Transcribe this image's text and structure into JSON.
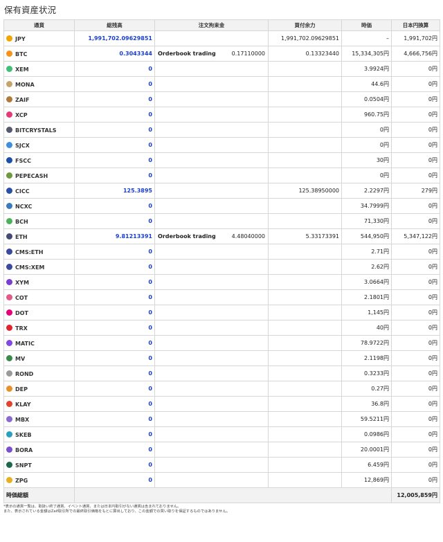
{
  "page_title": "保有資産状況",
  "columns": [
    "通貨",
    "総残高",
    "注文拘束金",
    "買付余力",
    "時価",
    "日本円換算"
  ],
  "rows": [
    {
      "sym": "JPY",
      "icon": "yen-icon",
      "color": "#f0a500",
      "balance": "1,991,702.09629851",
      "order_label": "",
      "order_amount": "",
      "buying_power": "1,991,702.09629851",
      "price": "–",
      "jpy": "1,991,702円"
    },
    {
      "sym": "BTC",
      "icon": "bitcoin-icon",
      "color": "#f7931a",
      "balance": "0.3043344",
      "order_label": "Orderbook trading",
      "order_amount": "0.17110000",
      "buying_power": "0.13323440",
      "price": "15,334,305円",
      "jpy": "4,666,756円"
    },
    {
      "sym": "XEM",
      "icon": "xem-icon",
      "color": "#41bf76",
      "balance": "0",
      "order_label": "",
      "order_amount": "",
      "buying_power": "",
      "price": "3.9924円",
      "jpy": "0円"
    },
    {
      "sym": "MONA",
      "icon": "mona-icon",
      "color": "#c5a46d",
      "balance": "0",
      "order_label": "",
      "order_amount": "",
      "buying_power": "",
      "price": "44.6円",
      "jpy": "0円"
    },
    {
      "sym": "ZAIF",
      "icon": "zaif-icon",
      "color": "#b07b3a",
      "balance": "0",
      "order_label": "",
      "order_amount": "",
      "buying_power": "",
      "price": "0.0504円",
      "jpy": "0円"
    },
    {
      "sym": "XCP",
      "icon": "xcp-icon",
      "color": "#e6397a",
      "balance": "0",
      "order_label": "",
      "order_amount": "",
      "buying_power": "",
      "price": "960.75円",
      "jpy": "0円"
    },
    {
      "sym": "BITCRYSTALS",
      "icon": "bitcrystals-icon",
      "color": "#555a70",
      "balance": "0",
      "order_label": "",
      "order_amount": "",
      "buying_power": "",
      "price": "0円",
      "jpy": "0円"
    },
    {
      "sym": "SJCX",
      "icon": "sjcx-icon",
      "color": "#3d8fe0",
      "balance": "0",
      "order_label": "",
      "order_amount": "",
      "buying_power": "",
      "price": "0円",
      "jpy": "0円"
    },
    {
      "sym": "FSCC",
      "icon": "fscc-icon",
      "color": "#1d4fa8",
      "balance": "0",
      "order_label": "",
      "order_amount": "",
      "buying_power": "",
      "price": "30円",
      "jpy": "0円"
    },
    {
      "sym": "PEPECASH",
      "icon": "pepecash-icon",
      "color": "#6d9a3a",
      "balance": "0",
      "order_label": "",
      "order_amount": "",
      "buying_power": "",
      "price": "0円",
      "jpy": "0円"
    },
    {
      "sym": "CICC",
      "icon": "cicc-icon",
      "color": "#2a4fa8",
      "balance": "125.3895",
      "order_label": "",
      "order_amount": "",
      "buying_power": "125.38950000",
      "price": "2.2297円",
      "jpy": "279円"
    },
    {
      "sym": "NCXC",
      "icon": "ncxc-icon",
      "color": "#3a7bbf",
      "balance": "0",
      "order_label": "",
      "order_amount": "",
      "buying_power": "",
      "price": "34.7999円",
      "jpy": "0円"
    },
    {
      "sym": "BCH",
      "icon": "bch-icon",
      "color": "#4cb25a",
      "balance": "0",
      "order_label": "",
      "order_amount": "",
      "buying_power": "",
      "price": "71,330円",
      "jpy": "0円"
    },
    {
      "sym": "ETH",
      "icon": "ethereum-icon",
      "color": "#454a75",
      "balance": "9.81213391",
      "order_label": "Orderbook trading",
      "order_amount": "4.48040000",
      "buying_power": "5.33173391",
      "price": "544,950円",
      "jpy": "5,347,122円"
    },
    {
      "sym": "CMS:ETH",
      "icon": "cms-eth-icon",
      "color": "#3b4aa0",
      "balance": "0",
      "order_label": "",
      "order_amount": "",
      "buying_power": "",
      "price": "2.71円",
      "jpy": "0円"
    },
    {
      "sym": "CMS:XEM",
      "icon": "cms-xem-icon",
      "color": "#3b4aa0",
      "balance": "0",
      "order_label": "",
      "order_amount": "",
      "buying_power": "",
      "price": "2.62円",
      "jpy": "0円"
    },
    {
      "sym": "XYM",
      "icon": "xym-icon",
      "color": "#7b3fd0",
      "balance": "0",
      "order_label": "",
      "order_amount": "",
      "buying_power": "",
      "price": "3.0664円",
      "jpy": "0円"
    },
    {
      "sym": "COT",
      "icon": "cot-icon",
      "color": "#e05a8a",
      "balance": "0",
      "order_label": "",
      "order_amount": "",
      "buying_power": "",
      "price": "2.1801円",
      "jpy": "0円"
    },
    {
      "sym": "DOT",
      "icon": "polkadot-icon",
      "color": "#e6007a",
      "balance": "0",
      "order_label": "",
      "order_amount": "",
      "buying_power": "",
      "price": "1,145円",
      "jpy": "0円"
    },
    {
      "sym": "TRX",
      "icon": "tron-icon",
      "color": "#e0242f",
      "balance": "0",
      "order_label": "",
      "order_amount": "",
      "buying_power": "",
      "price": "40円",
      "jpy": "0円"
    },
    {
      "sym": "MATIC",
      "icon": "polygon-icon",
      "color": "#8247e5",
      "balance": "0",
      "order_label": "",
      "order_amount": "",
      "buying_power": "",
      "price": "78.9722円",
      "jpy": "0円"
    },
    {
      "sym": "MV",
      "icon": "mv-icon",
      "color": "#3a8a4a",
      "balance": "0",
      "order_label": "",
      "order_amount": "",
      "buying_power": "",
      "price": "2.1198円",
      "jpy": "0円"
    },
    {
      "sym": "ROND",
      "icon": "rond-icon",
      "color": "#9a9a9a",
      "balance": "0",
      "order_label": "",
      "order_amount": "",
      "buying_power": "",
      "price": "0.3233円",
      "jpy": "0円"
    },
    {
      "sym": "DEP",
      "icon": "dep-icon",
      "color": "#e8902a",
      "balance": "0",
      "order_label": "",
      "order_amount": "",
      "buying_power": "",
      "price": "0.27円",
      "jpy": "0円"
    },
    {
      "sym": "KLAY",
      "icon": "klaytn-icon",
      "color": "#e0442a",
      "balance": "0",
      "order_label": "",
      "order_amount": "",
      "buying_power": "",
      "price": "36.8円",
      "jpy": "0円"
    },
    {
      "sym": "MBX",
      "icon": "mbx-icon",
      "color": "#8a6ad0",
      "balance": "0",
      "order_label": "",
      "order_amount": "",
      "buying_power": "",
      "price": "59.5211円",
      "jpy": "0円"
    },
    {
      "sym": "SKEB",
      "icon": "skeb-icon",
      "color": "#2aa0c0",
      "balance": "0",
      "order_label": "",
      "order_amount": "",
      "buying_power": "",
      "price": "0.0986円",
      "jpy": "0円"
    },
    {
      "sym": "BORA",
      "icon": "bora-icon",
      "color": "#7a4fd0",
      "balance": "0",
      "order_label": "",
      "order_amount": "",
      "buying_power": "",
      "price": "20.0001円",
      "jpy": "0円"
    },
    {
      "sym": "SNPT",
      "icon": "snpt-icon",
      "color": "#1a6a4a",
      "balance": "0",
      "order_label": "",
      "order_amount": "",
      "buying_power": "",
      "price": "6.459円",
      "jpy": "0円"
    },
    {
      "sym": "ZPG",
      "icon": "zpg-icon",
      "color": "#e8b020",
      "balance": "0",
      "order_label": "",
      "order_amount": "",
      "buying_power": "",
      "price": "12,869円",
      "jpy": "0円"
    }
  ],
  "total": {
    "label": "時価総額",
    "value": "12,005,859円"
  },
  "notes": [
    "*表示の通貨一覧は、取扱い終了通貨、イベント通貨、または日本円取引がない通貨は含まれておりません。",
    "また、表示されている金額はZaif取引所での最終取引価格をもとに算出しており、この金額での買い取りを保証するものではありません。"
  ]
}
